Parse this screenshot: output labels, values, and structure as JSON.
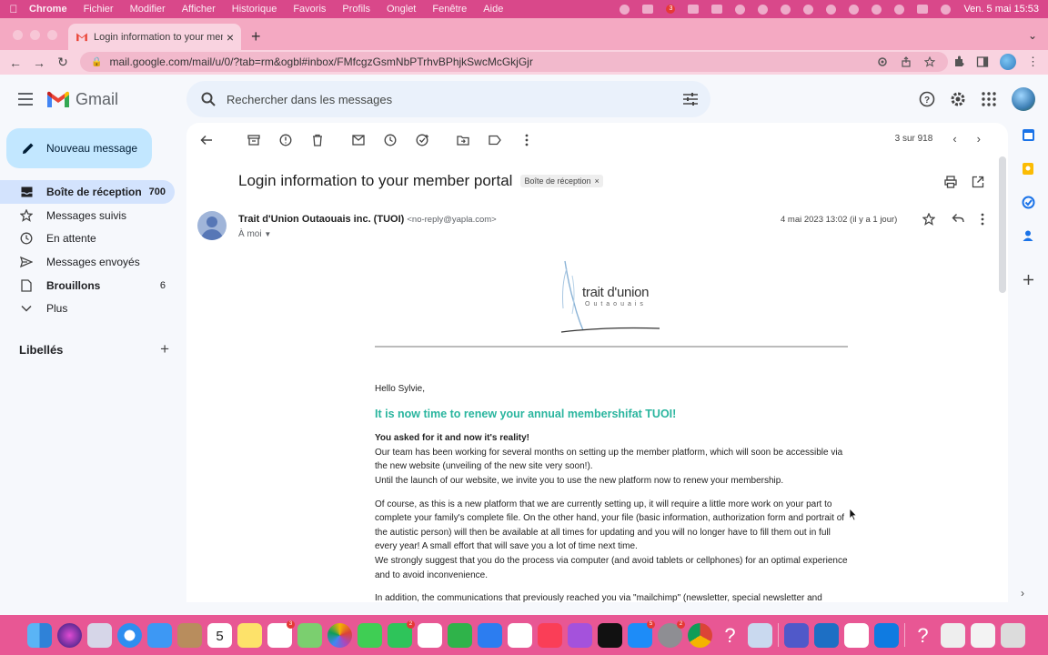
{
  "menubar": {
    "app": "Chrome",
    "items": [
      "Fichier",
      "Modifier",
      "Afficher",
      "Historique",
      "Favoris",
      "Profils",
      "Onglet",
      "Fenêtre",
      "Aide"
    ],
    "badge": "3",
    "datetime": "Ven. 5 mai  15:53"
  },
  "browser": {
    "tab_title": "Login information to your mem",
    "url": "mail.google.com/mail/u/0/?tab=rm&ogbl#inbox/FMfcgzGsmNbPTrhvBPhjkSwcMcGkjGjr"
  },
  "gmail": {
    "logo_text": "Gmail",
    "search_placeholder": "Rechercher dans les messages",
    "compose_label": "Nouveau message",
    "nav": [
      {
        "label": "Boîte de réception",
        "count": "700",
        "icon": "inbox-icon"
      },
      {
        "label": "Messages suivis",
        "count": "",
        "icon": "star-icon"
      },
      {
        "label": "En attente",
        "count": "",
        "icon": "clock-icon"
      },
      {
        "label": "Messages envoyés",
        "count": "",
        "icon": "send-icon"
      },
      {
        "label": "Brouillons",
        "count": "6",
        "icon": "draft-icon"
      },
      {
        "label": "Plus",
        "count": "",
        "icon": "chevron-down-icon"
      }
    ],
    "labels_heading": "Libellés"
  },
  "email": {
    "pager": "3 sur 918",
    "subject": "Login information to your member portal",
    "label_chip": "Boîte de réception",
    "sender_name": "Trait d'Union Outaouais inc. (TUOI)",
    "sender_email": "<no-reply@yapla.com>",
    "to_me": "À moi",
    "date": "4 mai 2023 13:02 (il y a 1 jour)",
    "logo_brand": "trait d'union",
    "logo_sub": "Outaouais",
    "greeting": "Hello Sylvie,",
    "headline": "It is now time to renew your annual membershifat TUOI!",
    "bold_line": "You asked for it and now it's reality!",
    "p1": "Our team has been working for several months on setting up the member platform, which will soon be accessible via the new website (unveiling of the new site very soon!).",
    "p1b": "Until the launch of our website, we invite you to use the new platform now to renew your membership.",
    "p2": "Of course, as this is a new platform that we are currently setting up, it will require a little more work on your part to complete your family's complete file. On the other hand, your file (basic information, authorization form and portrait of the autistic person) will then be available at all times for updating and you will no longer have to fill them out in full every year! A small effort that will save you a lot of time next time.",
    "p3": "We strongly suggest that you do the process via computer (and avoid tablets or cellphones) for an optimal experience and to avoid inconvenience.",
    "p4": "In addition, the communications that previously reached you via \"mailchimp\" (newsletter, special newsletter and"
  },
  "dock_badges": [
    "3",
    "2",
    "5",
    "2"
  ]
}
